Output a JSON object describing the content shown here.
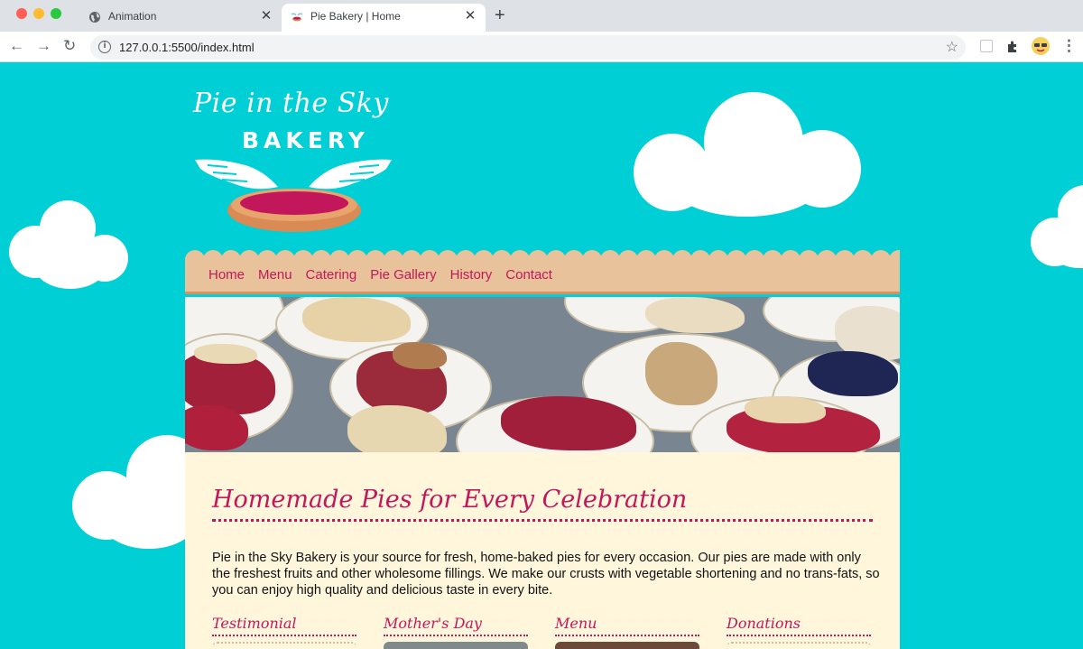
{
  "browser": {
    "tabs": [
      {
        "title": "Animation",
        "active": false,
        "icon": "globe-icon"
      },
      {
        "title": "Pie Bakery | Home",
        "active": true,
        "icon": "pie-favicon-icon"
      }
    ],
    "url": "127.0.0.1:5500/index.html"
  },
  "site": {
    "logo_script": "Pie in the Sky",
    "logo_word": "BAKERY",
    "nav": [
      "Home",
      "Menu",
      "Catering",
      "Pie Gallery",
      "History",
      "Contact"
    ],
    "heading": "Homemade Pies for Every Celebration",
    "intro": "Pie in the Sky Bakery is your source for fresh, home-baked pies for every occasion. Our pies are made with only the freshest fruits and other wholesome fillings. We make our crusts with vegetable shortening and no trans-fats, so you can enjoy high quality and delicious taste in every bite.",
    "sections": [
      "Testimonial",
      "Mother's Day",
      "Menu",
      "Donations"
    ]
  },
  "colors": {
    "sky": "#00cfd6",
    "accent": "#c2185b",
    "nav_bg": "#e8c29b",
    "content_bg": "#fff6dc"
  }
}
